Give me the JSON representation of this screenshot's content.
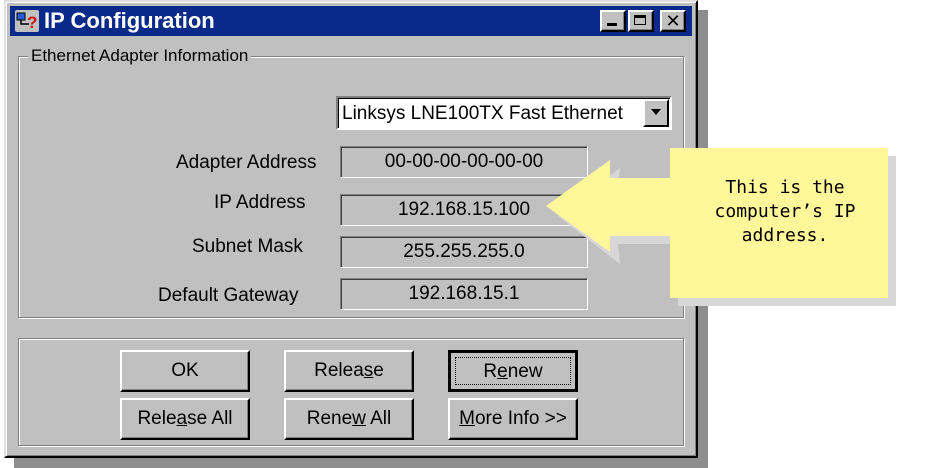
{
  "window": {
    "title": "IP Configuration",
    "icon": "network-icon"
  },
  "group": {
    "label": "Ethernet  Adapter Information"
  },
  "adapter_select": {
    "value": "Linksys LNE100TX Fast Ethernet"
  },
  "fields": {
    "adapter_address": {
      "label": "Adapter Address",
      "value": "00-00-00-00-00-00"
    },
    "ip_address": {
      "label": "IP Address",
      "value": "192.168.15.100"
    },
    "subnet_mask": {
      "label": "Subnet Mask",
      "value": "255.255.255.0"
    },
    "default_gateway": {
      "label": "Default Gateway",
      "value": "192.168.15.1"
    }
  },
  "buttons": {
    "ok": "OK",
    "release": "Release",
    "renew": "Renew",
    "release_all": "Release All",
    "renew_all": "Renew All",
    "more_info": "More Info >>"
  },
  "callout": {
    "line1": "This is the",
    "line2": "computer’s IP",
    "line3": "address."
  },
  "colors": {
    "titlebar": "#0a2a8a",
    "face": "#c0c0c0",
    "callout": "#fff79a"
  }
}
